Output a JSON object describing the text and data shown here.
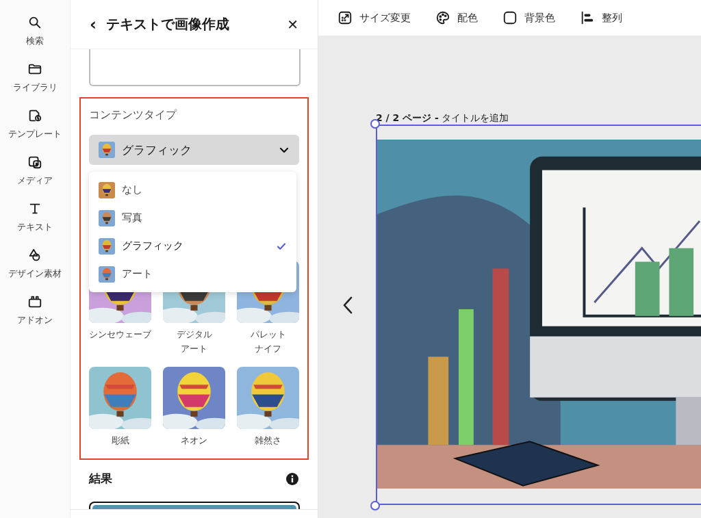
{
  "rail": [
    {
      "kind": "search",
      "label": "検索"
    },
    {
      "kind": "folder",
      "label": "ライブラリ"
    },
    {
      "kind": "template",
      "label": "テンプレート"
    },
    {
      "kind": "media",
      "label": "メディア"
    },
    {
      "kind": "text",
      "label": "テキスト"
    },
    {
      "kind": "shapes",
      "label": "デザイン素材"
    },
    {
      "kind": "addon",
      "label": "アドオン"
    }
  ],
  "panel": {
    "back": "‹",
    "title": "テキストで画像作成",
    "close": "✕",
    "content_type": {
      "label": "コンテンツタイプ",
      "value": "グラフィック",
      "options": [
        {
          "label": "なし",
          "selected": false
        },
        {
          "label": "写真",
          "selected": false
        },
        {
          "label": "グラフィック",
          "selected": true
        },
        {
          "label": "アート",
          "selected": false
        }
      ]
    },
    "styles": [
      {
        "label": "シンセウェーブ",
        "wrapped": false
      },
      {
        "label": "デジタルアート",
        "wrapped": true
      },
      {
        "label": "パレットナイフ",
        "wrapped": true
      },
      {
        "label": "彫紙",
        "wrapped": false
      },
      {
        "label": "ネオン",
        "wrapped": false
      },
      {
        "label": "雑然さ",
        "wrapped": false
      }
    ],
    "result_label": "結果"
  },
  "toolbar": [
    {
      "kind": "resize",
      "label": "サイズ変更"
    },
    {
      "kind": "palette",
      "label": "配色"
    },
    {
      "kind": "background",
      "label": "背景色"
    },
    {
      "kind": "align",
      "label": "整列"
    }
  ],
  "canvas": {
    "page_label": "**2 / 2 ページ -** タイトルを追加"
  }
}
